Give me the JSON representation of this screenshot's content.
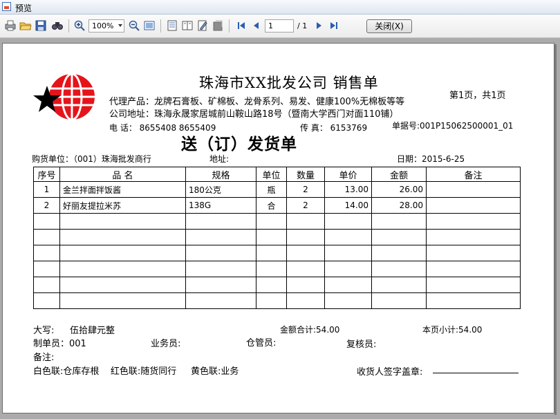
{
  "window": {
    "title": "预览"
  },
  "toolbar": {
    "icons": [
      "print-icon",
      "open-folder-icon",
      "save-icon",
      "find-icon",
      "zoom-in-icon",
      "zoom-out-icon",
      "whole-page-icon",
      "page-width-icon",
      "two-page-icon",
      "edit-icon",
      "options-icon",
      "first-page-icon",
      "previous-page-icon",
      "next-page-icon",
      "last-page-icon"
    ],
    "zoom": "100%",
    "page_current": "1",
    "page_total": "/ 1",
    "close_label": "关闭(X)"
  },
  "doc": {
    "company": "珠海市XX批发公司  销售单",
    "products": "代理产品：龙牌石膏板、矿棉板、龙骨系列、易发、健康100%无棉板等等",
    "address": "公司地址：珠海永晟家居城前山鞍山路18号（暨南大学西门对面110铺）",
    "phone": "电 话：  8655408   8655409",
    "fax": "传 真：  6153769",
    "doc_no": "单据号:001P15062500001_01",
    "page_info": "第1页，共1页",
    "title": "送（订）发货单",
    "buyer": "购货单位：（001）珠海批发商行",
    "buyer_addr": "地址:",
    "date": "日期：2015-6-25",
    "columns": [
      "序号",
      "品  名",
      "规格",
      "单位",
      "数量",
      "单价",
      "金额",
      "备注"
    ],
    "rows": [
      [
        "1",
        "金兰拌面拌饭酱",
        "180公克",
        "瓶",
        "2",
        "13.00",
        "26.00",
        ""
      ],
      [
        "2",
        "好丽友提拉米苏",
        "138G",
        "合",
        "2",
        "14.00",
        "28.00",
        ""
      ],
      [
        "",
        "",
        "",
        "",
        "",
        "",
        "",
        ""
      ],
      [
        "",
        "",
        "",
        "",
        "",
        "",
        "",
        ""
      ],
      [
        "",
        "",
        "",
        "",
        "",
        "",
        "",
        ""
      ],
      [
        "",
        "",
        "",
        "",
        "",
        "",
        "",
        ""
      ],
      [
        "",
        "",
        "",
        "",
        "",
        "",
        "",
        ""
      ],
      [
        "",
        "",
        "",
        "",
        "",
        "",
        "",
        ""
      ]
    ],
    "daxie": "大写:",
    "daxie_value": "伍拾肆元整",
    "total": "金额合计:54.00",
    "page_subtotal": "本页小计:54.00",
    "maker": "制单员：001",
    "salesman": "业务员:",
    "warehouse": "仓管员:",
    "reviewer": "复核员:",
    "remark": "备注:",
    "copies": "白色联:仓库存根    红色联:随货同行     黄色联:业务",
    "receiver": "收货人签字盖章:"
  }
}
